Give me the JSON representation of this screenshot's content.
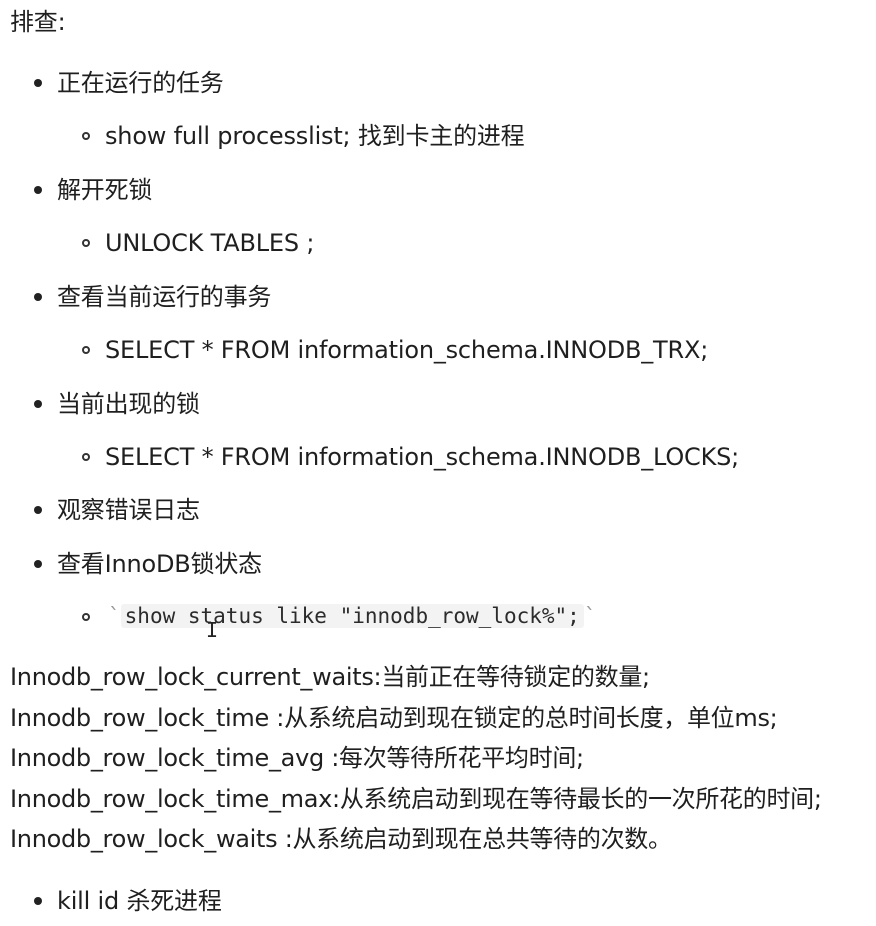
{
  "heading": "排查:",
  "items": [
    {
      "label": "正在运行的任务",
      "sub": "show full processlist;  找到卡主的进程"
    },
    {
      "label": "解开死锁",
      "sub": "UNLOCK TABLES ;"
    },
    {
      "label": "查看当前运行的事务",
      "sub": "SELECT * FROM information_schema.INNODB_TRX;"
    },
    {
      "label": "当前出现的锁",
      "sub": "SELECT * FROM information_schema.INNODB_LOCKS;"
    },
    {
      "label": "观察错误日志"
    },
    {
      "label": "查看InnoDB锁状态",
      "code": "show status like \"innodb_row_lock%\";",
      "tick": "`"
    }
  ],
  "descriptions": [
    "Innodb_row_lock_current_waits:当前正在等待锁定的数量;",
    "Innodb_row_lock_time :从系统启动到现在锁定的总时间长度，单位ms;",
    "Innodb_row_lock_time_avg :每次等待所花平均时间;",
    "Innodb_row_lock_time_max:从系统启动到现在等待最长的一次所花的时间;",
    "Innodb_row_lock_waits :从系统启动到现在总共等待的次数。"
  ],
  "last_item": {
    "label": "kill  id 杀死进程"
  }
}
